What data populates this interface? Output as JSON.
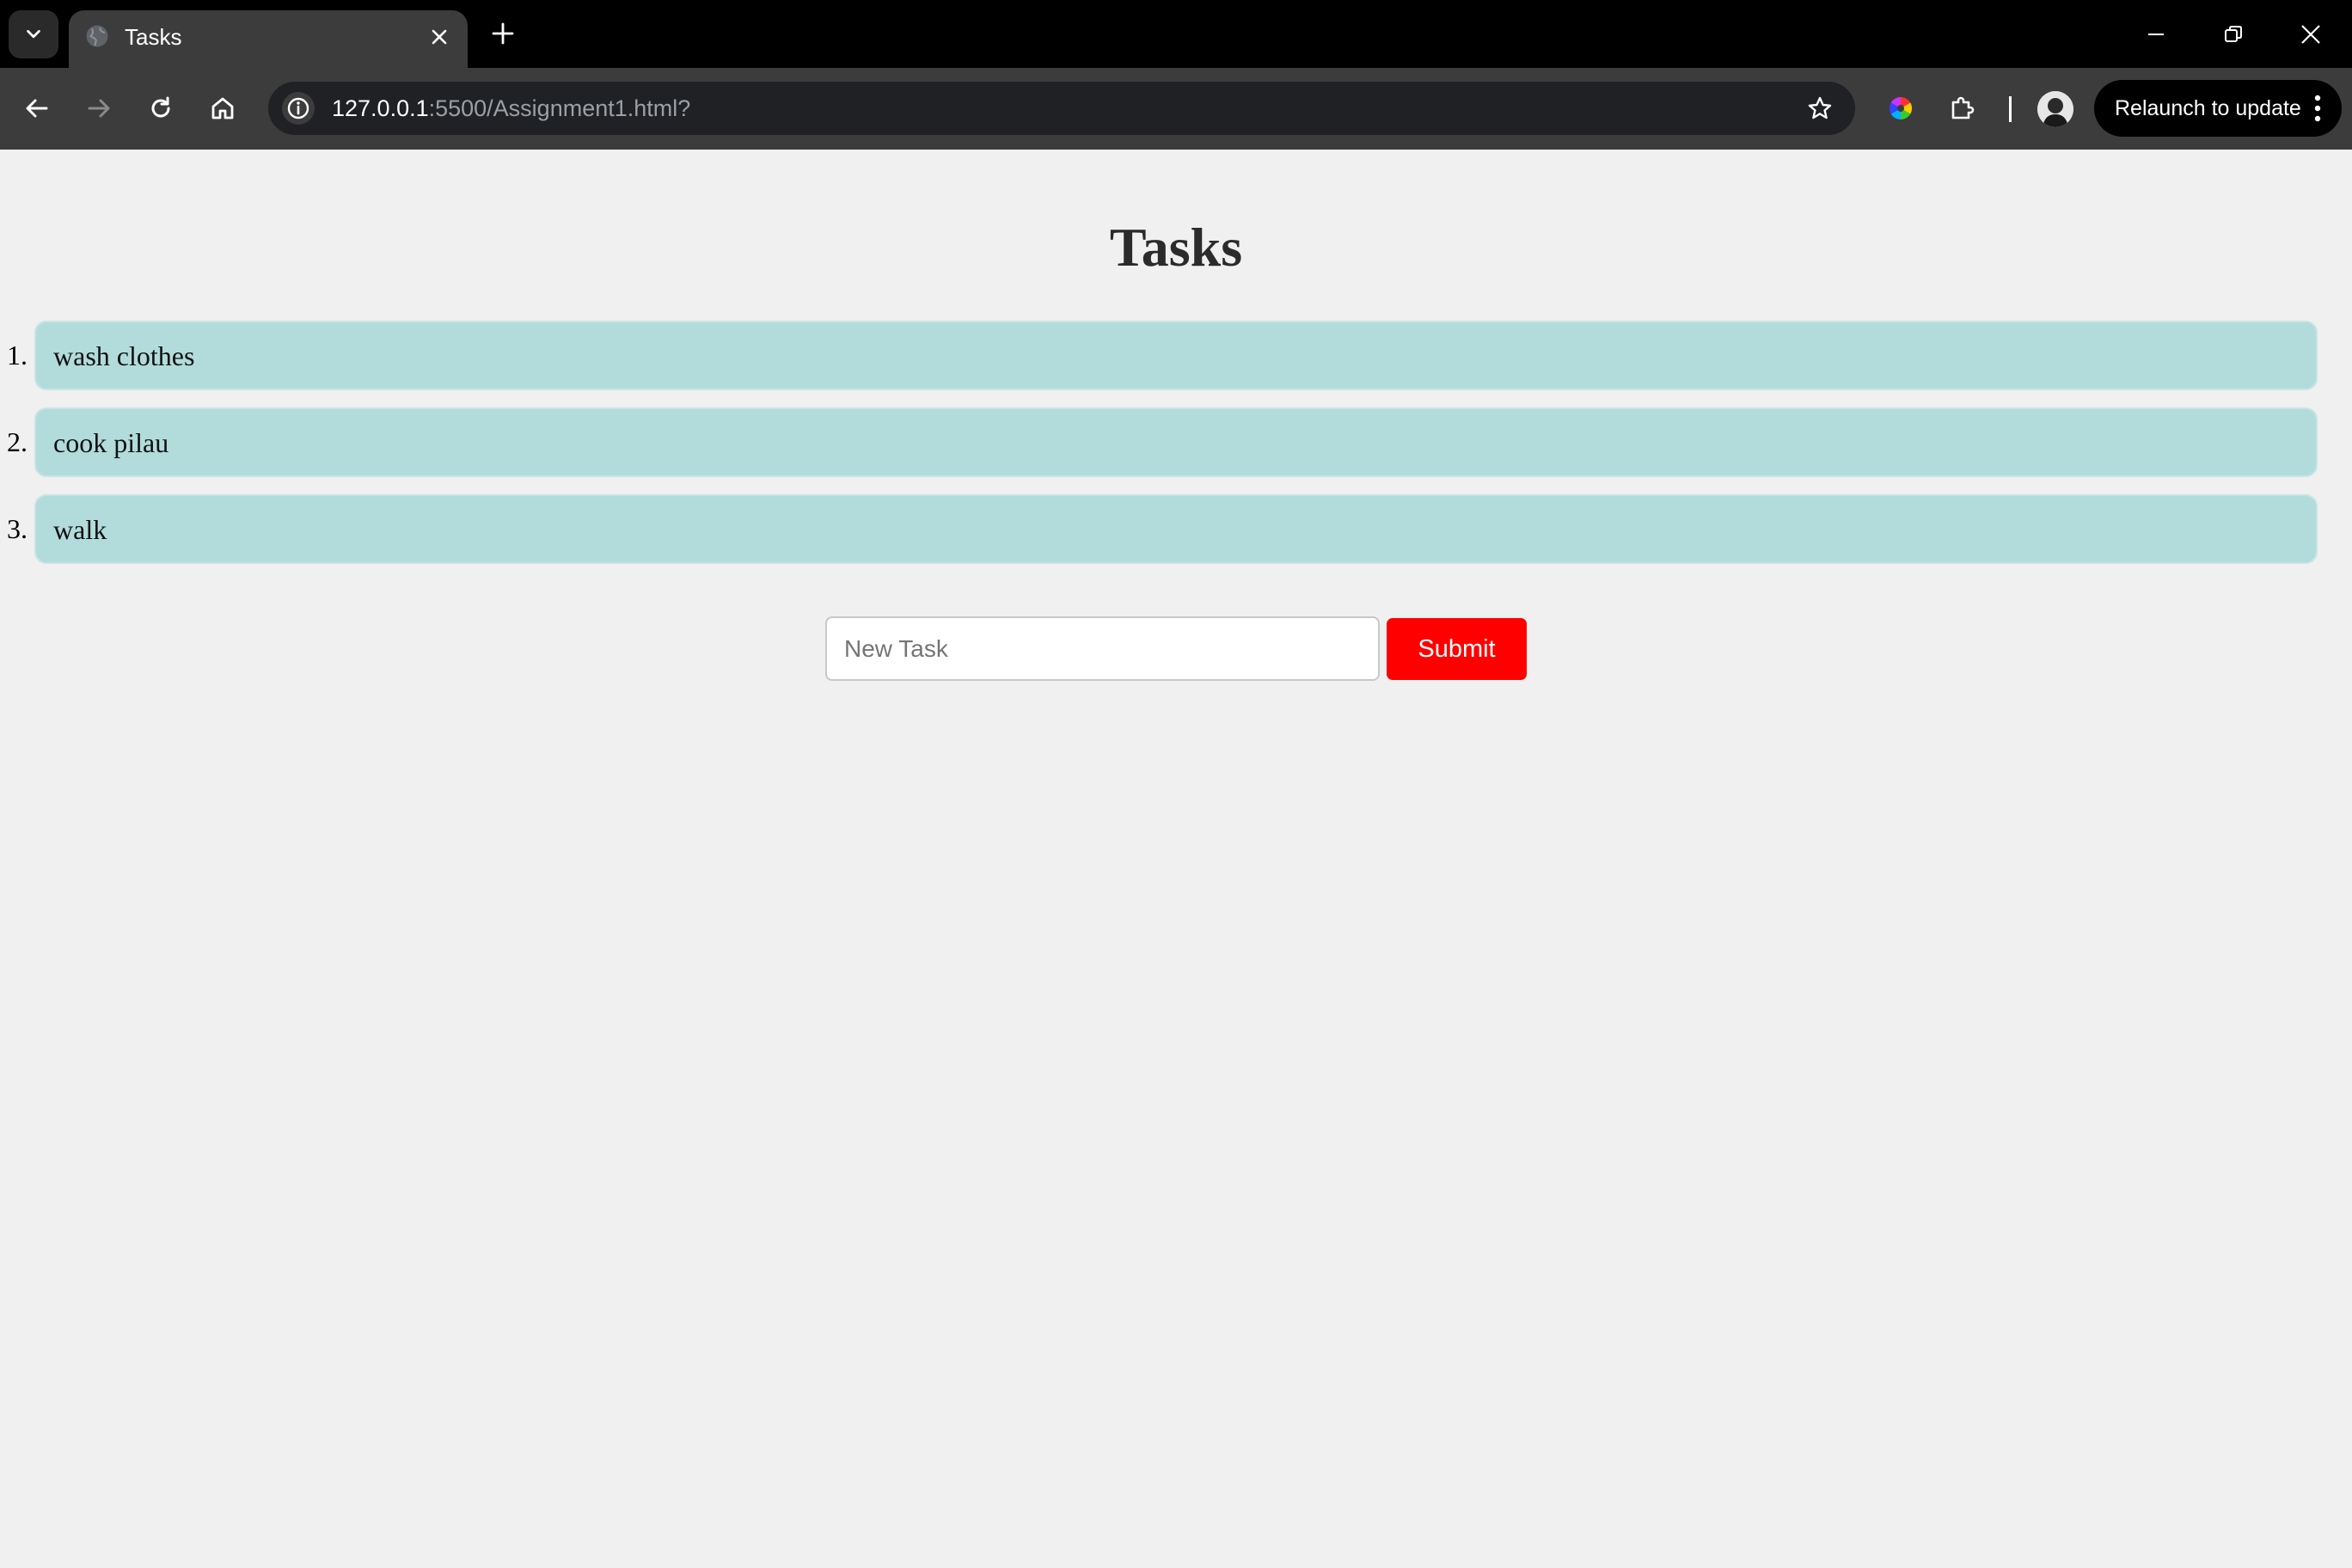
{
  "browser": {
    "tab": {
      "title": "Tasks",
      "favicon": "globe-icon",
      "close_icon": "close-icon"
    },
    "new_tab_icon": "plus-icon",
    "window_controls": [
      "minimize-icon",
      "restore-icon",
      "close-icon"
    ],
    "toolbar": {
      "back_icon": "arrow-left-icon",
      "forward_icon": "arrow-right-icon",
      "reload_icon": "reload-icon",
      "home_icon": "home-icon",
      "site_info_icon": "info-icon",
      "url_host": "127.0.0.1",
      "url_path": ":5500/Assignment1.html?",
      "bookmark_icon": "star-icon",
      "extension_icons": [
        "color-wheel-icon",
        "puzzle-icon"
      ],
      "relaunch_label": "Relaunch to update",
      "menu_icon": "more-vert-icon"
    }
  },
  "page": {
    "title": "Tasks",
    "tasks": [
      {
        "number": "1.",
        "text": "wash clothes"
      },
      {
        "number": "2.",
        "text": "cook pilau"
      },
      {
        "number": "3.",
        "text": "walk"
      }
    ],
    "form": {
      "placeholder": "New Task",
      "value": "",
      "submit_label": "Submit"
    }
  },
  "colors": {
    "chrome_frame": "#000000",
    "toolbar": "#3c3c3c",
    "page_background": "#f0f0f0",
    "task_item": "#b2dcdc",
    "submit_button": "#ff0000"
  }
}
